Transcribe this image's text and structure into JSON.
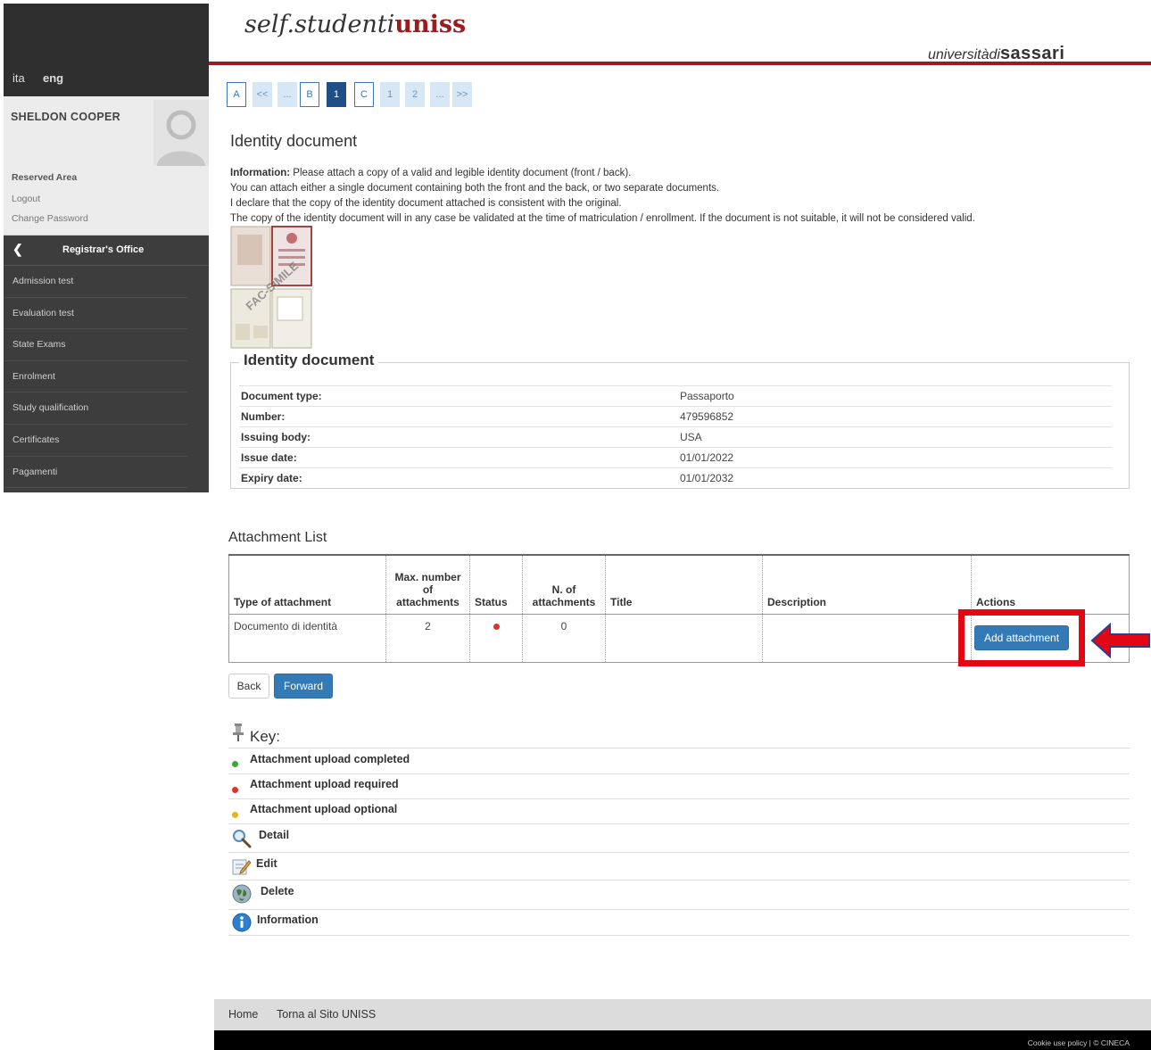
{
  "language": {
    "ita": "ita",
    "eng": "eng"
  },
  "user": {
    "name": "SHELDON COOPER"
  },
  "reserved_area": {
    "title": "Reserved Area",
    "logout": "Logout",
    "change_password": "Change Password"
  },
  "menu": {
    "title": "Registrar's Office",
    "back_icon": "chevron-left-icon",
    "items": [
      "Admission test",
      "Evaluation test",
      "State Exams",
      "Enrolment",
      "Study qualification",
      "Certificates",
      "Pagamenti"
    ]
  },
  "header": {
    "logo_main": "self.studenti",
    "logo_accent": "uniss",
    "university_prefix": "universitàdi",
    "university_name": "sassari"
  },
  "pager": [
    "A",
    "<<",
    "...",
    "B",
    "1",
    "C",
    "1",
    "2",
    "...",
    ">>"
  ],
  "page": {
    "title": "Identity document",
    "info_label": "Information:",
    "info_line1": " Please attach a copy of a valid and legible identity document (front / back).",
    "info_line2": "You can attach either a single document containing both the front and the back, or two separate documents.",
    "info_line3": "I declare that the copy of the identity document attached is consistent with the original.",
    "info_line4": "The copy of the identity document will in any case be validated at the time of matriculation / enrollment. If the document is not suitable, it will not be considered valid.",
    "sample_watermark": "FAC-SIMILE"
  },
  "identity": {
    "legend": "Identity document",
    "rows": [
      {
        "label": "Document type:",
        "value": "Passaporto"
      },
      {
        "label": "Number:",
        "value": "479596852"
      },
      {
        "label": "Issuing body:",
        "value": "USA"
      },
      {
        "label": "Issue date:",
        "value": "01/01/2022"
      },
      {
        "label": "Expiry date:",
        "value": "01/01/2032"
      }
    ]
  },
  "attachments": {
    "title": "Attachment List",
    "headers": {
      "type": "Type of attachment",
      "max_l1": "Max. number",
      "max_l2": "of",
      "max_l3": "attachments",
      "status": "Status",
      "n_l1": "N. of",
      "n_l2": "attachments",
      "title": "Title",
      "description": "Description",
      "actions": "Actions"
    },
    "row": {
      "type": "Documento di identità",
      "max": "2",
      "status_color": "#d9342b",
      "count": "0",
      "title": "",
      "description": ""
    },
    "add_button": "Add attachment"
  },
  "buttons": {
    "back": "Back",
    "forward": "Forward"
  },
  "key": {
    "title": "Key:",
    "items": [
      {
        "label": "Attachment upload completed",
        "color": "#3aa935"
      },
      {
        "label": "Attachment upload required",
        "color": "#d9342b"
      },
      {
        "label": "Attachment upload optional",
        "color": "#e0b526"
      },
      {
        "label": "Detail",
        "icon": "magnifier-icon"
      },
      {
        "label": "Edit",
        "icon": "edit-icon"
      },
      {
        "label": "Delete",
        "icon": "delete-icon"
      },
      {
        "label": "Information",
        "icon": "info-icon"
      }
    ]
  },
  "footer": {
    "home": "Home",
    "uniss": "Torna al Sito UNISS",
    "legal": "Cookie use policy | © CINECA"
  },
  "colors": {
    "brand_red": "#9a1c1f",
    "primary_blue": "#337ab7",
    "highlight_red": "#e30613"
  }
}
